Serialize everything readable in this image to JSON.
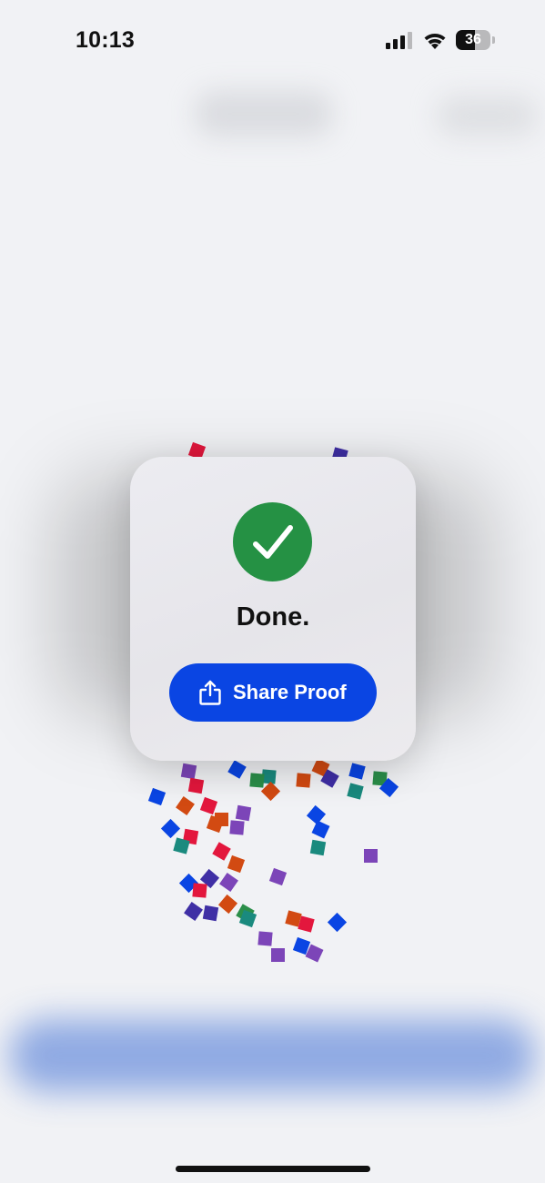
{
  "status_bar": {
    "time": "10:13",
    "battery_level": "36",
    "icons": [
      "signal-icon",
      "wifi-icon",
      "battery-icon"
    ]
  },
  "dialog": {
    "icon": "checkmark-circle-icon",
    "title": "Done.",
    "share_button": {
      "label": "Share Proof",
      "icon": "share-icon"
    }
  },
  "colors": {
    "background": "#f1f2f5",
    "success_green": "#259144",
    "button_blue": "#0a45e3",
    "card": "#e8e7ec",
    "confetti": [
      "#0a45e3",
      "#e3173d",
      "#7c45b8",
      "#1a8a7e",
      "#d24a12",
      "#3f2fa5",
      "#2b8f4a"
    ]
  }
}
